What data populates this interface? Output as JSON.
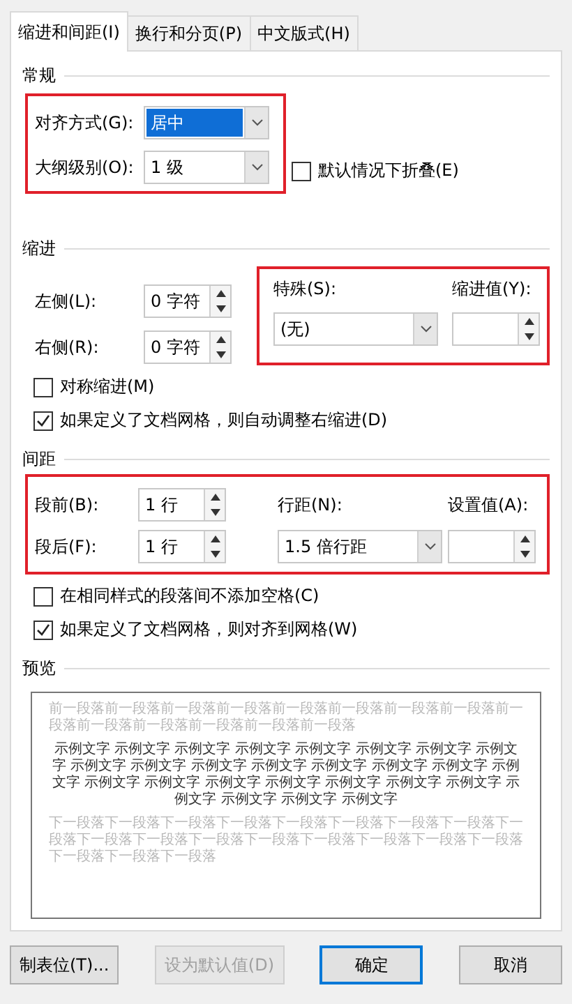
{
  "tabs": [
    {
      "label": "缩进和间距(I)",
      "selected": true
    },
    {
      "label": "换行和分页(P)",
      "selected": false
    },
    {
      "label": "中文版式(H)",
      "selected": false
    }
  ],
  "general": {
    "heading": "常规",
    "highlighted": true,
    "fields": [
      {
        "label": "对齐方式(G):",
        "value": "居中",
        "selected": true
      },
      {
        "label": "大纲级别(O):",
        "value": "1 级",
        "selected": false
      }
    ],
    "collapse": {
      "label": "默认情况下折叠(E)",
      "checked": false
    }
  },
  "indentation": {
    "heading": "缩进",
    "spinners": [
      {
        "label": "左侧(L):",
        "value": "0 字符"
      },
      {
        "label": "右侧(R):",
        "value": "0 字符"
      }
    ],
    "special": {
      "highlighted": true,
      "label": "特殊(S):",
      "value": "(无)",
      "by_label": "缩进值(Y):"
    },
    "checkboxes": [
      {
        "label": "对称缩进(M)",
        "checked": false
      },
      {
        "label": "如果定义了文档网格，则自动调整右缩进(D)",
        "checked": true
      }
    ]
  },
  "spacing": {
    "heading": "间距",
    "highlighted": true,
    "spinners": [
      {
        "label": "段前(B):",
        "value": "1 行"
      },
      {
        "label": "段后(F):",
        "value": "1 行"
      }
    ],
    "line_spacing_label": "行距(N):",
    "line_spacing_value": "1.5 倍行距",
    "at_label": "设置值(A):",
    "checkboxes": [
      {
        "label": "在相同样式的段落间不添加空格(C)",
        "checked": false
      },
      {
        "label": "如果定义了文档网格，则对齐到网格(W)",
        "checked": true
      }
    ]
  },
  "preview": {
    "heading": "预览",
    "previous_paragraph": "前一段落前一段落前一段落前一段落前一段落前一段落前一段落前一段落前一段落前一段落前一段落前一段落前一段落前一段落",
    "sample_text": "示例文字 示例文字 示例文字 示例文字 示例文字 示例文字 示例文字 示例文字 示例文字 示例文字 示例文字 示例文字 示例文字 示例文字 示例文字 示例文字 示例文字 示例文字 示例文字 示例文字 示例文字 示例文字 示例文字 示例文字 示例文字 示例文字 示例文字",
    "next_paragraph": "下一段落下一段落下一段落下一段落下一段落下一段落下一段落下一段落下一段落下一段落下一段落下一段落下一段落下一段落下一段落下一段落下一段落下一段落下一段落下一段落"
  },
  "buttons": [
    {
      "label": "制表位(T)...",
      "disabled": false,
      "default": false
    },
    {
      "label": "设为默认值(D)",
      "disabled": true,
      "default": false
    },
    {
      "label": "确定",
      "disabled": false,
      "default": true
    },
    {
      "label": "取消",
      "disabled": false,
      "default": false
    }
  ]
}
